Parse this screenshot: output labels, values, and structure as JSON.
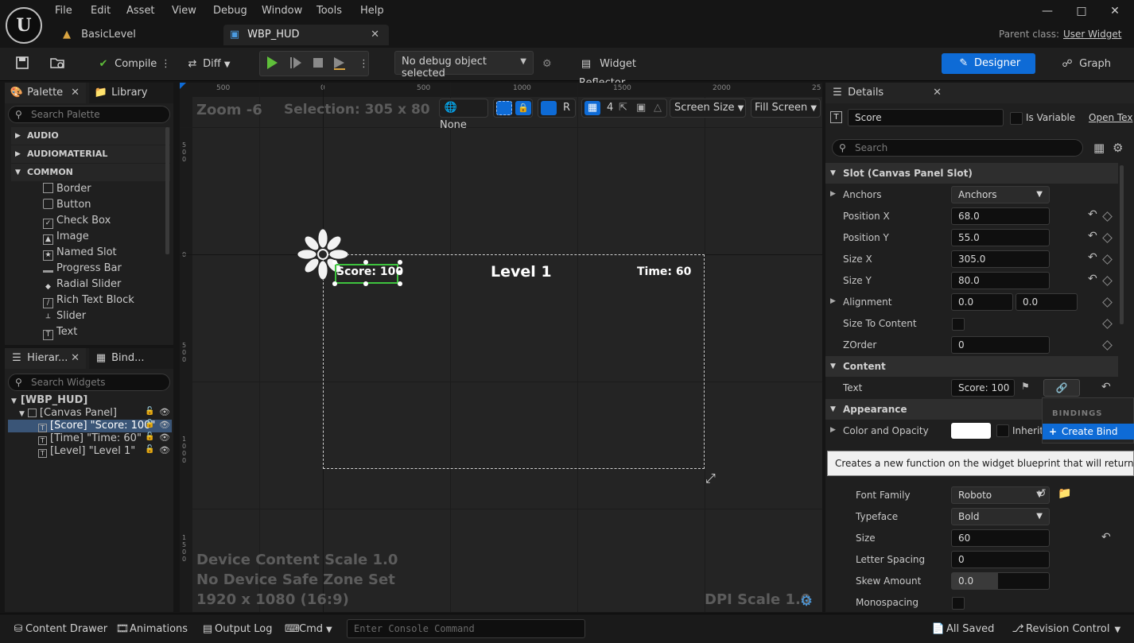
{
  "menu": [
    "File",
    "Edit",
    "Asset",
    "View",
    "Debug",
    "Window",
    "Tools",
    "Help"
  ],
  "tabs": {
    "level": "BasicLevel",
    "widget": "WBP_HUD"
  },
  "parent_class": {
    "label": "Parent class:",
    "value": "User Widget"
  },
  "toolbar": {
    "compile": "Compile",
    "diff": "Diff",
    "debug_object": "No debug object selected",
    "widget_reflector": "Widget Reflector",
    "designer": "Designer",
    "graph": "Graph"
  },
  "palette": {
    "tab": "Palette",
    "library_tab": "Library",
    "search_placeholder": "Search Palette",
    "categories": [
      "AUDIO",
      "AUDIOMATERIAL",
      "COMMON"
    ],
    "items": [
      "Border",
      "Button",
      "Check Box",
      "Image",
      "Named Slot",
      "Progress Bar",
      "Radial Slider",
      "Rich Text Block",
      "Slider",
      "Text"
    ]
  },
  "hierarchy": {
    "tab": "Hierar...",
    "bind_tab": "Bind...",
    "search_placeholder": "Search Widgets",
    "root": "[WBP_HUD]",
    "canvas": "[Canvas Panel]",
    "children": [
      "[Score] \"Score: 100\"",
      "[Time] \"Time: 60\"",
      "[Level] \"Level 1\""
    ]
  },
  "canvas": {
    "zoom": "Zoom -6",
    "selection": "Selection: 305 x 80",
    "ruler_top": [
      "500",
      "0",
      "500",
      "1000",
      "1500",
      "2000",
      "25"
    ],
    "ruler_left": [
      "5\n0\n0",
      "0",
      "5\n0\n0",
      "1\n0\n0\n0",
      "1\n5\n0\n0"
    ],
    "toolbar": {
      "none": "None",
      "r": "R",
      "grid": "4",
      "screen_size": "Screen Size",
      "fill_screen": "Fill Screen"
    },
    "widgets": {
      "score": "Score: 100",
      "level": "Level 1",
      "time": "Time: 60"
    },
    "footer": [
      "Device Content Scale 1.0",
      "No Device Safe Zone Set",
      "1920 x 1080 (16:9)"
    ],
    "dpi": "DPI Scale 1.0"
  },
  "details": {
    "tab": "Details",
    "name": "Score",
    "is_variable": "Is Variable",
    "open": "Open Tex",
    "search_placeholder": "Search",
    "slot_section": "Slot (Canvas Panel Slot)",
    "anchors_label": "Anchors",
    "anchors_value": "Anchors",
    "position_x": {
      "label": "Position X",
      "value": "68.0"
    },
    "position_y": {
      "label": "Position Y",
      "value": "55.0"
    },
    "size_x": {
      "label": "Size X",
      "value": "305.0"
    },
    "size_y": {
      "label": "Size Y",
      "value": "80.0"
    },
    "alignment": {
      "label": "Alignment",
      "x": "0.0",
      "y": "0.0"
    },
    "size_to_content": "Size To Content",
    "zorder": {
      "label": "ZOrder",
      "value": "0"
    },
    "content_section": "Content",
    "text": {
      "label": "Text",
      "value": "Score: 100"
    },
    "appearance_section": "Appearance",
    "color": {
      "label": "Color and Opacity",
      "inherit": "Inherit"
    },
    "tooltip": "Creates a new function on the widget blueprint that will return the bind",
    "bindings_header": "BINDINGS",
    "create_binding": "Create Bind",
    "font_family": {
      "label": "Font Family",
      "value": "Roboto"
    },
    "typeface": {
      "label": "Typeface",
      "value": "Bold"
    },
    "size": {
      "label": "Size",
      "value": "60"
    },
    "letter_spacing": {
      "label": "Letter Spacing",
      "value": "0"
    },
    "skew": {
      "label": "Skew Amount",
      "value": "0.0"
    },
    "monospacing": "Monospacing"
  },
  "statusbar": {
    "content_drawer": "Content Drawer",
    "animations": "Animations",
    "output_log": "Output Log",
    "cmd": "Cmd",
    "console_placeholder": "Enter Console Command",
    "all_saved": "All Saved",
    "revision": "Revision Control"
  },
  "colors": {
    "accent": "#0e6bd6",
    "selection_green": "#3ec43e",
    "bg": "#151515"
  }
}
